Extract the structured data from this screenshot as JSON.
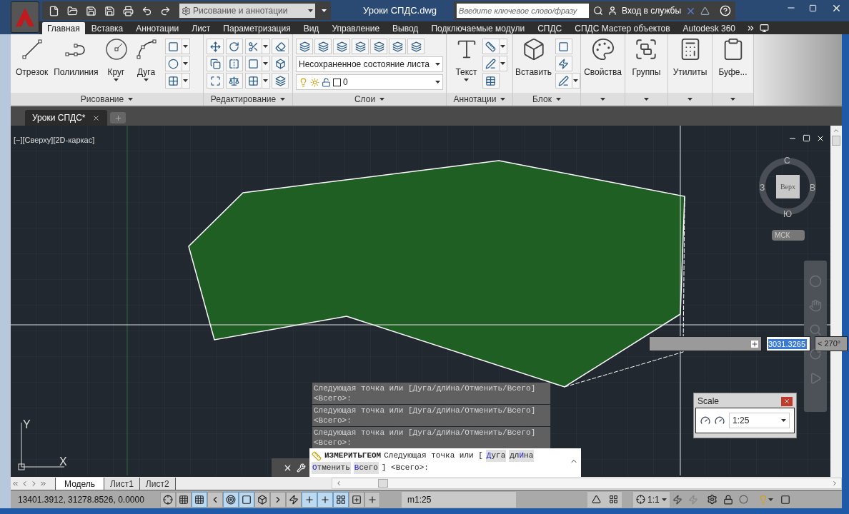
{
  "title_bar": {
    "workspace": "Рисование и аннотации",
    "file_title": "Уроки СПДС.dwg",
    "search_placeholder": "Введите ключевое слово/фразу",
    "sign_in": "Вход в службы"
  },
  "ribbon_tabs": [
    {
      "label": "Главная",
      "selected": true
    },
    {
      "label": "Вставка",
      "selected": false
    },
    {
      "label": "Аннотации",
      "selected": false
    },
    {
      "label": "Лист",
      "selected": false
    },
    {
      "label": "Параметризация",
      "selected": false
    },
    {
      "label": "Вид",
      "selected": false
    },
    {
      "label": "Управление",
      "selected": false
    },
    {
      "label": "Вывод",
      "selected": false
    },
    {
      "label": "Подключаемые модули",
      "selected": false
    },
    {
      "label": "СПДС",
      "selected": false
    },
    {
      "label": "СПДС Мастер объектов",
      "selected": false
    },
    {
      "label": "Autodesk 360",
      "selected": false
    }
  ],
  "ribbon_panels": [
    {
      "kind": "draw",
      "title": "Рисование",
      "tools": [
        {
          "label": "Отрезок",
          "dropdown": false
        },
        {
          "label": "Полилиния",
          "dropdown": false
        },
        {
          "label": "Круг",
          "dropdown": true
        },
        {
          "label": "Дуга",
          "dropdown": true
        }
      ]
    },
    {
      "kind": "modify",
      "title": "Редактирование"
    },
    {
      "kind": "layers",
      "title": "Слои",
      "layer_state": "Несохраненное состояние листа",
      "layer": "0"
    },
    {
      "kind": "large",
      "title": "Аннотации",
      "tools": [
        {
          "label": "Текст",
          "dropdown": true
        }
      ]
    },
    {
      "kind": "large",
      "title": "Блок",
      "tools": [
        {
          "label": "Вставить",
          "dropdown": false
        }
      ]
    },
    {
      "kind": "large",
      "tools": [
        {
          "label": "Свойства",
          "dropdown": false
        }
      ]
    },
    {
      "kind": "large",
      "tools": [
        {
          "label": "Группы",
          "dropdown": false
        }
      ]
    },
    {
      "kind": "large",
      "tools": [
        {
          "label": "Утилиты",
          "dropdown": false
        }
      ]
    },
    {
      "kind": "large",
      "tools": [
        {
          "label": "Буфе...",
          "dropdown": false
        }
      ]
    }
  ],
  "file_tabs": [
    {
      "label": "Уроки СПДС*",
      "selected": true
    }
  ],
  "viewport": {
    "label": "[−][Сверху][2D-каркас]",
    "viewcube": {
      "north": "С",
      "west": "З",
      "east": "В",
      "south": "Ю",
      "face": "Верх",
      "ucs": "МСК"
    },
    "ucs_icon": {
      "x_label": "X",
      "y_label": "Y"
    }
  },
  "dynamic_input": {
    "value": "3031.3265",
    "angle": "< 270°"
  },
  "command_history": [
    {
      "lines": [
        "Следующая точка или [Дуга/длИна/Отменить/Всего]",
        "<Всего>:"
      ]
    },
    {
      "lines": [
        "Следующая точка или [Дуга/длИна/Отменить/Всего]",
        "<Всего>:"
      ]
    },
    {
      "lines": [
        "Следующая точка или [Дуга/длИна/Отменить/Всего]",
        "<Всего>:"
      ]
    }
  ],
  "command_line": {
    "command": "ИЗМЕРИТЬГЕОМ",
    "prompt": "Следующая точка или [",
    "options": [
      {
        "key": "Д",
        "rest": "уга"
      },
      {
        "lead": "дл",
        "key": "И",
        "rest": "на"
      },
      {
        "key": "О",
        "rest": "тменить"
      },
      {
        "key": "В",
        "rest": "сего"
      }
    ],
    "tail": "] <Всего>:"
  },
  "scale_window": {
    "title": "Scale",
    "value": "1:25"
  },
  "layout_tabs": [
    {
      "label": "Модель",
      "selected": true
    },
    {
      "label": "Лист1",
      "selected": false
    },
    {
      "label": "Лист2",
      "selected": false
    }
  ],
  "status_bar": {
    "coordinates": "13401.3912, 31278.8526, 0.0000",
    "toggles": [
      {
        "on": false
      },
      {
        "on": false
      },
      {
        "on": true
      },
      {
        "on": false
      },
      {
        "on": true
      },
      {
        "on": true
      },
      {
        "on": false
      },
      {
        "on": false
      },
      {
        "on": false
      },
      {
        "on": true
      },
      {
        "on": true
      },
      {
        "on": true
      },
      {
        "on": false
      },
      {
        "on": false
      }
    ],
    "model_scale": "m1:25",
    "annotation_scale": "1:1"
  }
}
